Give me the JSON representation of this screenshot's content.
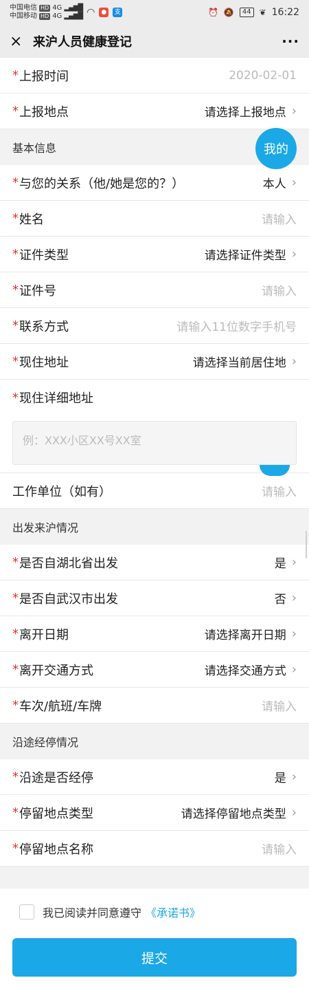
{
  "status_bar": {
    "carrier1": "中国电信",
    "carrier2": "中国移动",
    "hd_label": "HD",
    "net1": "4G",
    "net2": "4G",
    "app1_icon": "app-badge-icon",
    "app2_label": "支",
    "battery": "44",
    "time": "16:22"
  },
  "nav": {
    "close_icon": "×",
    "title": "来沪人员健康登记",
    "more_icon": "···"
  },
  "required_mark": "*",
  "chevron": "›",
  "rows": {
    "report_time": {
      "label": "上报时间",
      "value": "2020-02-01"
    },
    "report_place": {
      "label": "上报地点",
      "value": "请选择上报地点"
    },
    "section_basic": "基本信息",
    "mine_bubble": "我的",
    "relation": {
      "label": "与您的关系（他/她是您的？）",
      "value": "本人"
    },
    "name": {
      "label": "姓名",
      "placeholder": "请输入"
    },
    "id_type": {
      "label": "证件类型",
      "value": "请选择证件类型"
    },
    "id_no": {
      "label": "证件号",
      "placeholder": "请输入"
    },
    "contact": {
      "label": "联系方式",
      "placeholder": "请输入11位数字手机号"
    },
    "address": {
      "label": "现住地址",
      "value": "请选择当前居住地"
    },
    "address_detail": {
      "label": "现住详细地址",
      "placeholder": "例：XXX小区XX号XX室"
    },
    "work_unit": {
      "label": "工作单位（如有）",
      "placeholder": "请输入"
    },
    "section_depart": "出发来沪情况",
    "from_hubei": {
      "label": "是否自湖北省出发",
      "value": "是"
    },
    "from_wuhan": {
      "label": "是否自武汉市出发",
      "value": "否"
    },
    "leave_date": {
      "label": "离开日期",
      "value": "请选择离开日期"
    },
    "leave_transport": {
      "label": "离开交通方式",
      "value": "请选择交通方式"
    },
    "vehicle_no": {
      "label": "车次/航班/车牌",
      "placeholder": "请输入"
    },
    "section_stopover": "沿途经停情况",
    "stopover": {
      "label": "沿途是否经停",
      "value": "是"
    },
    "stop_type": {
      "label": "停留地点类型",
      "value": "请选择停留地点类型"
    },
    "stop_name": {
      "label": "停留地点名称",
      "placeholder": "请输入"
    }
  },
  "footer": {
    "agree_text": "我已阅读并同意遵守",
    "agree_link": "《承诺书》",
    "submit": "提交"
  },
  "colors": {
    "accent": "#1ba8e6",
    "required": "#e0342b"
  }
}
